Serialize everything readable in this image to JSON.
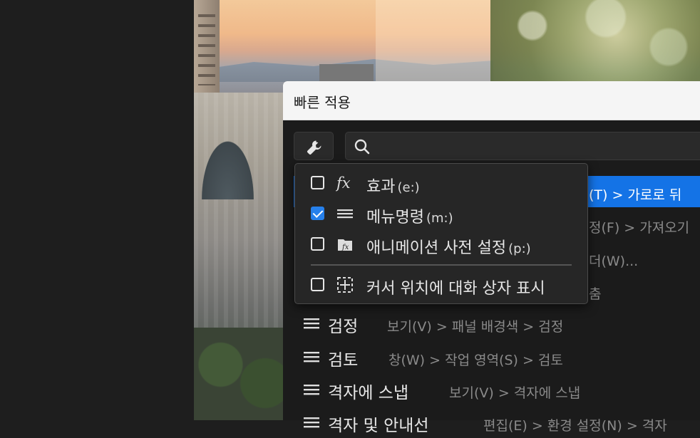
{
  "dialog": {
    "title": "빠른 적용",
    "search": {
      "value": "",
      "placeholder": ""
    }
  },
  "filter_menu": {
    "items": [
      {
        "label": "효과",
        "shortcut": "(e:)",
        "checked": false,
        "icon": "fx-icon"
      },
      {
        "label": "메뉴명령",
        "shortcut": "(m:)",
        "checked": true,
        "icon": "menu-lines-icon"
      },
      {
        "label": "애니메이션 사전 설정",
        "shortcut": "(p:)",
        "checked": false,
        "icon": "animation-preset-icon"
      },
      {
        "label": "커서 위치에 대화 상자 표시",
        "shortcut": "",
        "checked": false,
        "icon": "cursor-position-icon"
      }
    ]
  },
  "results": [
    {
      "name": "",
      "path": "(T) > 가로로 뒤",
      "selected": true
    },
    {
      "name": "",
      "path": "정(F) > 가져오기",
      "selected": false
    },
    {
      "name": "",
      "path": "더(W)...",
      "selected": false
    },
    {
      "name": "",
      "path": "춤",
      "selected": false
    },
    {
      "name": "검정",
      "path": "보기(V) > 패널 배경색 > 검정",
      "selected": false
    },
    {
      "name": "검토",
      "path": "창(W) > 작업 영역(S) > 검토",
      "selected": false
    },
    {
      "name": "격자에 스냅",
      "path": "보기(V) > 격자에 스냅",
      "selected": false
    },
    {
      "name": "격자 및 안내선",
      "path": "편집(E) > 환경 설정(N) > 격자",
      "selected": false
    }
  ],
  "colors": {
    "accent": "#1473e6",
    "checkbox_checked": "#2680eb",
    "panel_bg": "#1b1b1b",
    "title_bg": "#f5f5f5"
  }
}
